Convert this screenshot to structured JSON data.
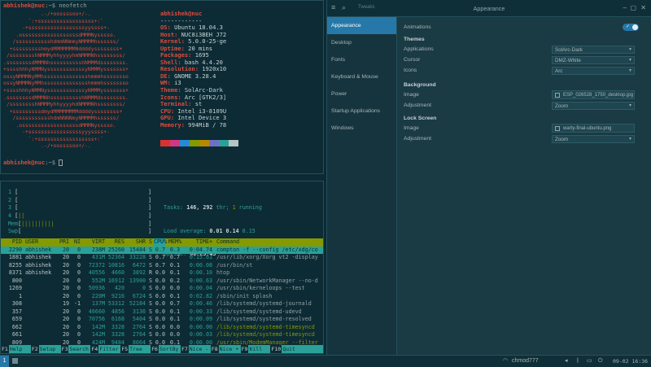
{
  "term_top": {
    "prompt1_user": "abhishek@nuc",
    "prompt1_rest": ":~$ neofetch",
    "ascii": [
      "            .-/+oossssoo+/-.",
      "        `:+ssssssssssssssssss+:`",
      "      -+ssssssssssssssssssyyssss+-",
      "    .ossssssssssssssssssdMMMNysssso.",
      "   /ssssssssssshdmmNNmmyNMMMMhssssss/",
      "  +ssssssssshmydMMMMMMMNddddyssssssss+",
      " /sssssssshNMMMyhhyyyyhmNMMMNhssssssss/",
      ".ssssssssdMMMNhsssssssssshNMMMdssssssss.",
      "+sssshhhyNMMNyssssssssssssyNMMMysssssss+",
      "ossyNMMMNyMMhsssssssssssssshmmmhssssssso",
      "ossyNMMMNyMMhsssssssssssssshmmmhssssssso",
      "+sssshhhyNMMNyssssssssssssyNMMMysssssss+",
      ".ssssssssdMMMNhsssssssssshNMMMdssssssss.",
      " /sssssssshNMMMyhhyyyyhdNMMMNhssssssss/",
      "  +sssssssssdmydMMMMMMMMddddyssssssss+",
      "   /ssssssssssshdmNNNNmyNMMMMhssssss/",
      "    .ossssssssssssssssssdMMMNysssso.",
      "      -+sssssssssssssssssyyyssss+-",
      "        `:+ssssssssssssssssss+:`",
      "            .-/+oossssoo+/-."
    ],
    "userhost": "abhishek@nuc",
    "separator": "------------",
    "info": [
      {
        "key": "OS",
        "value": "Ubuntu 18.04.3"
      },
      {
        "key": "Host",
        "value": "NUC8i3BEH J72"
      },
      {
        "key": "Kernel",
        "value": "5.0.0-25-ge"
      },
      {
        "key": "Uptime",
        "value": "20 mins"
      },
      {
        "key": "Packages",
        "value": "1695"
      },
      {
        "key": "Shell",
        "value": "bash 4.4.20"
      },
      {
        "key": "Resolution",
        "value": "1920x10"
      },
      {
        "key": "DE",
        "value": "GNOME 3.28.4"
      },
      {
        "key": "WM",
        "value": "i3"
      },
      {
        "key": "Theme",
        "value": "SolArc-Dark"
      },
      {
        "key": "Icons",
        "value": "Arc [GTK2/3]"
      },
      {
        "key": "Terminal",
        "value": "st"
      },
      {
        "key": "CPU",
        "value": "Intel i3-8109U"
      },
      {
        "key": "GPU",
        "value": "Intel Device 3"
      },
      {
        "key": "Memory",
        "value": "994MiB / 78"
      }
    ],
    "swatch_colors": [
      "#dc322f",
      "#d33682",
      "#268bd2",
      "#859900",
      "#b58900",
      "#6c71c4",
      "#2aa198",
      "#b8c4c4"
    ],
    "prompt2_user": "abhishek@nuc",
    "prompt2_rest": ":~$"
  },
  "htop": {
    "meters": [
      {
        "num": "1",
        "bar": "",
        "close": "]"
      },
      {
        "num": "2",
        "bar": "",
        "close": "]"
      },
      {
        "num": "3",
        "bar": "",
        "close": "]"
      },
      {
        "num": "4",
        "bar": "||",
        "close": "]"
      }
    ],
    "mem_label": "Mem",
    "mem_bar": "||||||||||",
    "swp_label": "Swp",
    "tasks_label": "Tasks:",
    "tasks_value": "146,",
    "threads_value": "292",
    "thr_label": "thr;",
    "running_value": "1",
    "running_label": "running",
    "load_label": "Load average:",
    "load_1": "0.01",
    "load_5": "0.14",
    "load_15": "0.15",
    "uptime_label": "Uptime:",
    "uptime_value": "00:25:43",
    "header": {
      "pid": "PID",
      "user": "USER",
      "pri": "PRI",
      "ni": "NI",
      "virt": "VIRT",
      "res": "RES",
      "shr": "SHR",
      "s": "S",
      "cpu": "CPU%",
      "mem": "MEM%",
      "time": "TIME+",
      "cmd": "Command"
    },
    "rows": [
      {
        "pid": "2290",
        "user": "abhishek",
        "pri": "20",
        "ni": "0",
        "virt": "238M",
        "res": "25260",
        "shr": "15484",
        "s": "S",
        "cpu": "0.7",
        "mem": "0.3",
        "time": "0:04.74",
        "cmd": "compton -f --config /etc/xdg/co"
      },
      {
        "pid": "1881",
        "user": "abhishek",
        "pri": "20",
        "ni": "0",
        "virt": "431M",
        "res": "52364",
        "shr": "33228",
        "s": "S",
        "cpu": "0.7",
        "mem": "0.7",
        "time": "0:15.61",
        "cmd": "/usr/lib/xorg/Xorg vt2 -display"
      },
      {
        "pid": "8255",
        "user": "abhishek",
        "pri": "20",
        "ni": "0",
        "virt": "72372",
        "res": "10816",
        "shr": "6472",
        "s": "S",
        "cpu": "0.7",
        "mem": "0.1",
        "time": "0:00.08",
        "cmd": "/usr/bin/st"
      },
      {
        "pid": "8371",
        "user": "abhishek",
        "pri": "20",
        "ni": "0",
        "virt": "40556",
        "res": "4660",
        "shr": "3892",
        "s": "R",
        "cpu": "0.0",
        "mem": "0.1",
        "time": "0:00.10",
        "cmd": "htop"
      },
      {
        "pid": "800",
        "user": "",
        "pri": "20",
        "ni": "0",
        "virt": "552M",
        "res": "16912",
        "shr": "13900",
        "s": "S",
        "cpu": "0.0",
        "mem": "0.2",
        "time": "0:00.63",
        "cmd": "/usr/sbin/NetworkManager --no-d"
      },
      {
        "pid": "1269",
        "user": "",
        "pri": "20",
        "ni": "0",
        "virt": "50936",
        "res": "420",
        "shr": "0",
        "s": "S",
        "cpu": "0.0",
        "mem": "0.0",
        "time": "0:00.04",
        "cmd": "/usr/sbin/kerneloops --test"
      },
      {
        "pid": "1",
        "user": "",
        "pri": "20",
        "ni": "0",
        "virt": "220M",
        "res": "9216",
        "shr": "6724",
        "s": "S",
        "cpu": "0.0",
        "mem": "0.1",
        "time": "0:02.82",
        "cmd": "/sbin/init splash"
      },
      {
        "pid": "308",
        "user": "",
        "pri": "19",
        "ni": "-1",
        "virt": "137M",
        "res": "53312",
        "shr": "52184",
        "s": "S",
        "cpu": "0.0",
        "mem": "0.7",
        "time": "0:00.46",
        "cmd": "/lib/systemd/systemd-journald"
      },
      {
        "pid": "357",
        "user": "",
        "pri": "20",
        "ni": "0",
        "virt": "46660",
        "res": "4856",
        "shr": "3136",
        "s": "S",
        "cpu": "0.0",
        "mem": "0.1",
        "time": "0:00.33",
        "cmd": "/lib/systemd/systemd-udevd"
      },
      {
        "pid": "659",
        "user": "",
        "pri": "20",
        "ni": "0",
        "virt": "70756",
        "res": "6168",
        "shr": "5404",
        "s": "S",
        "cpu": "0.0",
        "mem": "0.1",
        "time": "0:00.09",
        "cmd": "/lib/systemd/systemd-resolved"
      },
      {
        "pid": "662",
        "user": "",
        "pri": "20",
        "ni": "0",
        "virt": "142M",
        "res": "3328",
        "shr": "2764",
        "s": "S",
        "cpu": "0.0",
        "mem": "0.0",
        "time": "0:00.00",
        "cmd": "/lib/systemd/systemd-timesyncd"
      },
      {
        "pid": "661",
        "user": "",
        "pri": "20",
        "ni": "0",
        "virt": "142M",
        "res": "3328",
        "shr": "2764",
        "s": "S",
        "cpu": "0.0",
        "mem": "0.0",
        "time": "0:00.03",
        "cmd": "/lib/systemd/systemd-timesyncd"
      },
      {
        "pid": "809",
        "user": "",
        "pri": "20",
        "ni": "0",
        "virt": "424M",
        "res": "9484",
        "shr": "8064",
        "s": "S",
        "cpu": "0.0",
        "mem": "0.1",
        "time": "0:00.00",
        "cmd": "/usr/sbin/ModemManager --filter"
      },
      {
        "pid": "850",
        "user": "",
        "pri": "20",
        "ni": "0",
        "virt": "424M",
        "res": "9484",
        "shr": "8064",
        "s": "S",
        "cpu": "0.0",
        "mem": "0.1",
        "time": "0:00.00",
        "cmd": "/usr/sbin/ModemManager --filter"
      }
    ],
    "fkeys": [
      {
        "key": "F1",
        "label": "Help"
      },
      {
        "key": "F2",
        "label": "Setup"
      },
      {
        "key": "F3",
        "label": "Search"
      },
      {
        "key": "F4",
        "label": "Filter"
      },
      {
        "key": "F5",
        "label": "Tree"
      },
      {
        "key": "F6",
        "label": "SortBy"
      },
      {
        "key": "F7",
        "label": "Nice -"
      },
      {
        "key": "F8",
        "label": "Nice +"
      },
      {
        "key": "F9",
        "label": "Kill"
      },
      {
        "key": "F10",
        "label": "Quit"
      }
    ]
  },
  "settings": {
    "title": "Appearance",
    "search_hint": "Tweaks",
    "sidebar": [
      "Appearance",
      "Desktop",
      "Fonts",
      "Keyboard & Mouse",
      "Power",
      "Startup Applications",
      "Windows"
    ],
    "animations_label": "Animations",
    "themes_heading": "Themes",
    "applications_label": "Applications",
    "applications_value": "SolArc-Dark",
    "cursor_label": "Cursor",
    "cursor_value": "DMZ-White",
    "icons_label": "Icons",
    "icons_value": "Arc",
    "background_heading": "Background",
    "image_label": "Image",
    "bg_image_value": "ESP_026528_1750_desktop.jpg",
    "adjustment_label": "Adjustment",
    "bg_adjustment_value": "Zoom",
    "lock_heading": "Lock Screen",
    "lock_image_label": "Image",
    "lock_image_value": "warty-final-ubuntu.png",
    "lock_adjustment_label": "Adjustment",
    "lock_adjustment_value": "Zoom",
    "accent": "#2678a8"
  },
  "panel": {
    "workspace": "1",
    "network_label": "chmod777",
    "clock": "09-02 16:36"
  }
}
